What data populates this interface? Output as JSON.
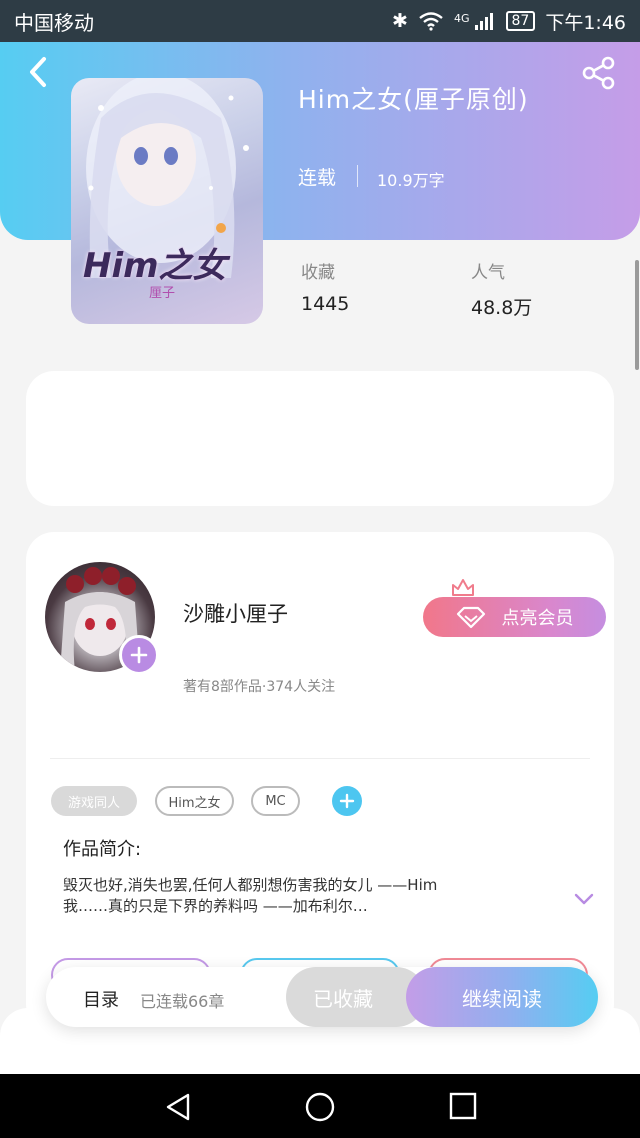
{
  "status_bar": {
    "carrier": "中国移动",
    "battery": "87",
    "time": "下午1:46",
    "network": "4G"
  },
  "book": {
    "title": "Him之女(厘子原创)",
    "status": "连载",
    "word_count": "10.9万字",
    "cover_text": "Him之女",
    "cover_subtext": "厘子"
  },
  "stats": {
    "favorites_label": "收藏",
    "favorites_value": "1445",
    "popularity_label": "人气",
    "popularity_value": "48.8万"
  },
  "author": {
    "name": "沙雕小厘子",
    "meta": "著有8部作品·374人关注",
    "vip_button": "点亮会员"
  },
  "tags": [
    "游戏同人",
    "Him之女",
    "MC"
  ],
  "intro": {
    "heading": "作品简介:",
    "line1": "毁灭也好,消失也罢,任何人都别想伤害我的女儿  ——Him",
    "line2": "我……真的只是下界的养料吗  ——加布利尔…"
  },
  "action_bar": {
    "toc_label": "目录",
    "chapters": "已连载66章",
    "favorited_label": "已收藏",
    "read_label": "继续阅读"
  },
  "colors": {
    "gradient_start": "#56cdf2",
    "gradient_end": "#c59de8",
    "vip_start": "#f1778a",
    "accent_purple": "#b98be3",
    "accent_blue": "#4dc6f0"
  }
}
